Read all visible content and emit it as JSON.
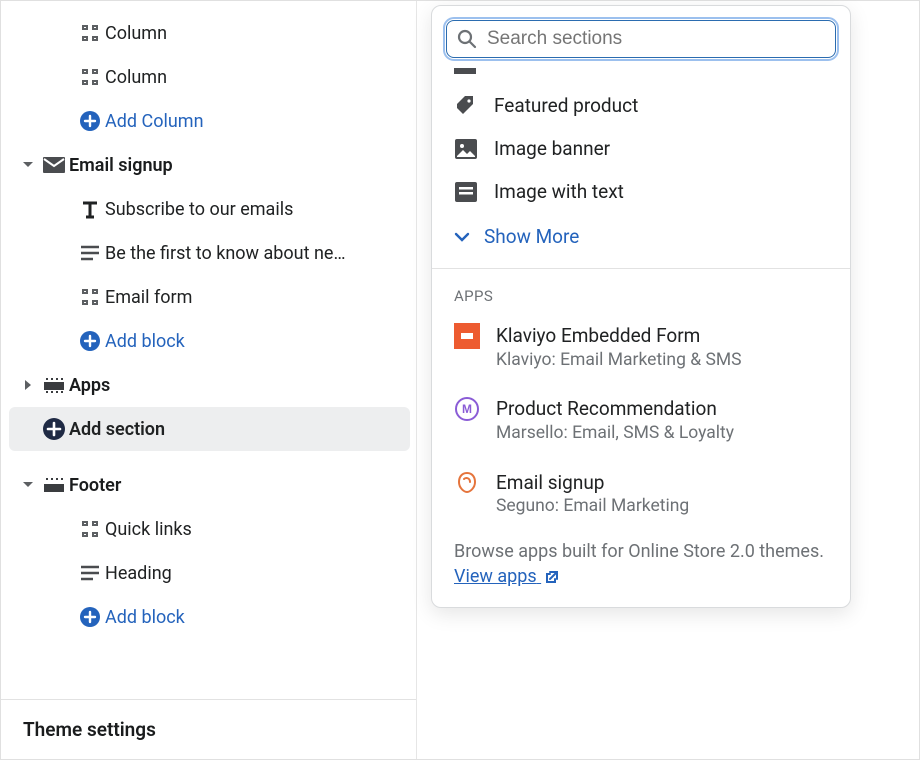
{
  "sidebar": {
    "rows": [
      {
        "label": "Column"
      },
      {
        "label": "Column"
      },
      {
        "label": "Add Column"
      },
      {
        "label": "Email signup"
      },
      {
        "label": "Subscribe to our emails"
      },
      {
        "label": "Be the first to know about ne…"
      },
      {
        "label": "Email form"
      },
      {
        "label": "Add block"
      },
      {
        "label": "Apps"
      },
      {
        "label": "Add section"
      },
      {
        "label": "Footer"
      },
      {
        "label": "Quick links"
      },
      {
        "label": "Heading"
      },
      {
        "label": "Add block"
      }
    ],
    "theme_settings": "Theme settings"
  },
  "search": {
    "placeholder": "Search sections"
  },
  "sections": {
    "items": [
      {
        "label": "Featured product"
      },
      {
        "label": "Image banner"
      },
      {
        "label": "Image with text"
      }
    ],
    "show_more": "Show More"
  },
  "apps": {
    "heading": "APPS",
    "items": [
      {
        "title": "Klaviyo Embedded Form",
        "subtitle": "Klaviyo: Email Marketing & SMS"
      },
      {
        "title": "Product Recommendation",
        "subtitle": "Marsello: Email, SMS & Loyalty"
      },
      {
        "title": "Email signup",
        "subtitle": "Seguno: Email Marketing"
      }
    ],
    "footnote_a": "Browse apps built for Online Store 2.0 themes. ",
    "footnote_link": "View apps"
  }
}
